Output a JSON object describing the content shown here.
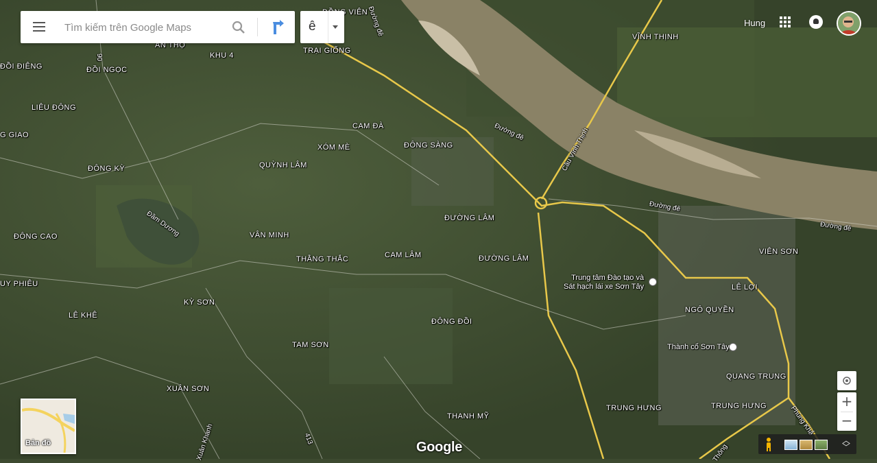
{
  "search": {
    "placeholder": "Tìm kiếm trên Google Maps",
    "menu_icon": "hamburger-menu-icon",
    "search_icon": "magnifier-icon",
    "directions_icon": "directions-arrow-icon"
  },
  "language": {
    "char": "ê",
    "caret_icon": "caret-down-icon"
  },
  "account": {
    "user_name": "Hung",
    "apps_icon": "apps-grid-icon",
    "notif_icon": "notifications-icon"
  },
  "minimap": {
    "label": "Bản đồ"
  },
  "controls": {
    "zoom_in": "+",
    "zoom_out": "−",
    "location_icon": "my-location-icon",
    "expand_icon": "expand-icon"
  },
  "brand": {
    "logo": "Google"
  },
  "colors": {
    "river": "#8a8266",
    "road": "#e8c84a",
    "land": "#3d4a30"
  },
  "labels": {
    "dong_vien": "ĐỒNG VIÊN",
    "duong_de_top": "Đường đê",
    "vinh_thinh": "VĨNH THỊNH",
    "an_tho": "AN THỌ",
    "khu4": "KHU 4",
    "trai_giong": "TRẠI GIỐNG",
    "doi_dieng": "ĐỒI ĐIÊNG",
    "doi_ngoc": "ĐỒI NGỌC",
    "lieu_dong": "LIÊU ĐÔNG",
    "giao": "G GIAO",
    "cam_da": "CAM ĐÀ",
    "xom_me": "XÓM MÈ",
    "dong_sang": "ĐÔNG SÀNG",
    "duong_de_mid": "Đường đê",
    "cau_vinh_thinh": "Cầu Vĩnh Thịnh",
    "dong_ky": "ĐÔNG KỲ",
    "quynh_lam": "QUỲNH LÂM",
    "dam_duong": "Đầm Dương",
    "duong_de_right": "Đường đê",
    "duong_de_far": "Đường đê",
    "duong_lam_1": "ĐƯỜNG LÂM",
    "dong_cao": "ĐÔNG CAO",
    "van_minh": "VÂN MINH",
    "vien_son": "VIÊN SƠN",
    "thang_thac": "THẰNG THẮC",
    "cam_lam": "CAM LÂM",
    "duong_lam_2": "ĐƯỜNG LÂM",
    "uy_phieu": "UY PHIÊU",
    "training_center_1": "Trung tâm Đào tạo và",
    "training_center_2": "Sát hạch lái xe Sơn Tây",
    "le_loi": "LÊ LỢI",
    "ky_son": "KỲ SƠN",
    "ngo_quyen": "NGÔ QUYỀN",
    "le_khe": "LÊ KHÊ",
    "dong_doi": "ĐÔNG ĐỒI",
    "thanh_co": "Thành cổ Sơn Tây",
    "tam_son": "TAM SƠN",
    "quang_trung": "QUANG TRUNG",
    "xuan_son": "XUÂN SƠN",
    "trung_hung_1": "TRUNG HƯNG",
    "trung_hung_2": "TRUNG HƯNG",
    "thanh_my": "THANH MỸ",
    "phung_khac": "Phùng Khắ",
    "xuan_khanh": "Xuân Khanh",
    "thong": "Thông",
    "road_90": "90",
    "road_413": "413"
  }
}
